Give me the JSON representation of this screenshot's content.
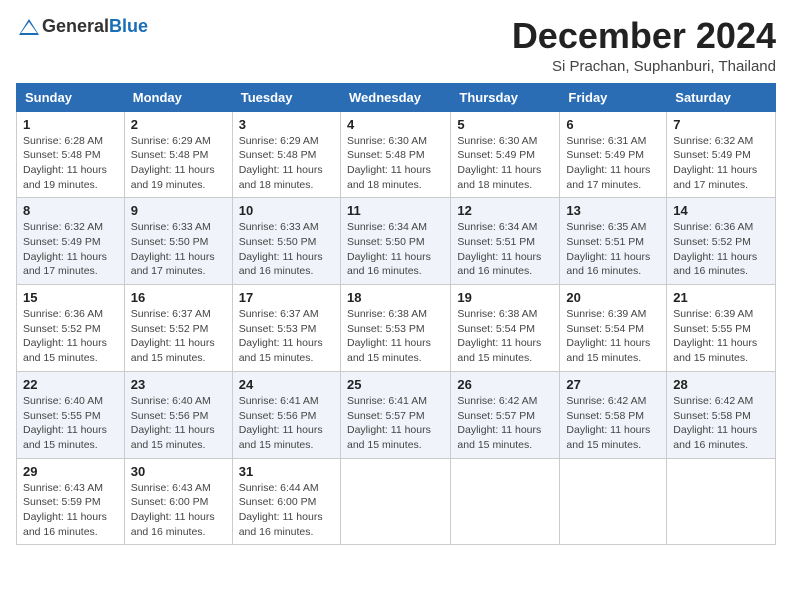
{
  "header": {
    "logo_general": "General",
    "logo_blue": "Blue",
    "title": "December 2024",
    "subtitle": "Si Prachan, Suphanburi, Thailand"
  },
  "weekdays": [
    "Sunday",
    "Monday",
    "Tuesday",
    "Wednesday",
    "Thursday",
    "Friday",
    "Saturday"
  ],
  "weeks": [
    [
      {
        "day": "1",
        "sunrise": "Sunrise: 6:28 AM",
        "sunset": "Sunset: 5:48 PM",
        "daylight": "Daylight: 11 hours and 19 minutes."
      },
      {
        "day": "2",
        "sunrise": "Sunrise: 6:29 AM",
        "sunset": "Sunset: 5:48 PM",
        "daylight": "Daylight: 11 hours and 19 minutes."
      },
      {
        "day": "3",
        "sunrise": "Sunrise: 6:29 AM",
        "sunset": "Sunset: 5:48 PM",
        "daylight": "Daylight: 11 hours and 18 minutes."
      },
      {
        "day": "4",
        "sunrise": "Sunrise: 6:30 AM",
        "sunset": "Sunset: 5:48 PM",
        "daylight": "Daylight: 11 hours and 18 minutes."
      },
      {
        "day": "5",
        "sunrise": "Sunrise: 6:30 AM",
        "sunset": "Sunset: 5:49 PM",
        "daylight": "Daylight: 11 hours and 18 minutes."
      },
      {
        "day": "6",
        "sunrise": "Sunrise: 6:31 AM",
        "sunset": "Sunset: 5:49 PM",
        "daylight": "Daylight: 11 hours and 17 minutes."
      },
      {
        "day": "7",
        "sunrise": "Sunrise: 6:32 AM",
        "sunset": "Sunset: 5:49 PM",
        "daylight": "Daylight: 11 hours and 17 minutes."
      }
    ],
    [
      {
        "day": "8",
        "sunrise": "Sunrise: 6:32 AM",
        "sunset": "Sunset: 5:49 PM",
        "daylight": "Daylight: 11 hours and 17 minutes."
      },
      {
        "day": "9",
        "sunrise": "Sunrise: 6:33 AM",
        "sunset": "Sunset: 5:50 PM",
        "daylight": "Daylight: 11 hours and 17 minutes."
      },
      {
        "day": "10",
        "sunrise": "Sunrise: 6:33 AM",
        "sunset": "Sunset: 5:50 PM",
        "daylight": "Daylight: 11 hours and 16 minutes."
      },
      {
        "day": "11",
        "sunrise": "Sunrise: 6:34 AM",
        "sunset": "Sunset: 5:50 PM",
        "daylight": "Daylight: 11 hours and 16 minutes."
      },
      {
        "day": "12",
        "sunrise": "Sunrise: 6:34 AM",
        "sunset": "Sunset: 5:51 PM",
        "daylight": "Daylight: 11 hours and 16 minutes."
      },
      {
        "day": "13",
        "sunrise": "Sunrise: 6:35 AM",
        "sunset": "Sunset: 5:51 PM",
        "daylight": "Daylight: 11 hours and 16 minutes."
      },
      {
        "day": "14",
        "sunrise": "Sunrise: 6:36 AM",
        "sunset": "Sunset: 5:52 PM",
        "daylight": "Daylight: 11 hours and 16 minutes."
      }
    ],
    [
      {
        "day": "15",
        "sunrise": "Sunrise: 6:36 AM",
        "sunset": "Sunset: 5:52 PM",
        "daylight": "Daylight: 11 hours and 15 minutes."
      },
      {
        "day": "16",
        "sunrise": "Sunrise: 6:37 AM",
        "sunset": "Sunset: 5:52 PM",
        "daylight": "Daylight: 11 hours and 15 minutes."
      },
      {
        "day": "17",
        "sunrise": "Sunrise: 6:37 AM",
        "sunset": "Sunset: 5:53 PM",
        "daylight": "Daylight: 11 hours and 15 minutes."
      },
      {
        "day": "18",
        "sunrise": "Sunrise: 6:38 AM",
        "sunset": "Sunset: 5:53 PM",
        "daylight": "Daylight: 11 hours and 15 minutes."
      },
      {
        "day": "19",
        "sunrise": "Sunrise: 6:38 AM",
        "sunset": "Sunset: 5:54 PM",
        "daylight": "Daylight: 11 hours and 15 minutes."
      },
      {
        "day": "20",
        "sunrise": "Sunrise: 6:39 AM",
        "sunset": "Sunset: 5:54 PM",
        "daylight": "Daylight: 11 hours and 15 minutes."
      },
      {
        "day": "21",
        "sunrise": "Sunrise: 6:39 AM",
        "sunset": "Sunset: 5:55 PM",
        "daylight": "Daylight: 11 hours and 15 minutes."
      }
    ],
    [
      {
        "day": "22",
        "sunrise": "Sunrise: 6:40 AM",
        "sunset": "Sunset: 5:55 PM",
        "daylight": "Daylight: 11 hours and 15 minutes."
      },
      {
        "day": "23",
        "sunrise": "Sunrise: 6:40 AM",
        "sunset": "Sunset: 5:56 PM",
        "daylight": "Daylight: 11 hours and 15 minutes."
      },
      {
        "day": "24",
        "sunrise": "Sunrise: 6:41 AM",
        "sunset": "Sunset: 5:56 PM",
        "daylight": "Daylight: 11 hours and 15 minutes."
      },
      {
        "day": "25",
        "sunrise": "Sunrise: 6:41 AM",
        "sunset": "Sunset: 5:57 PM",
        "daylight": "Daylight: 11 hours and 15 minutes."
      },
      {
        "day": "26",
        "sunrise": "Sunrise: 6:42 AM",
        "sunset": "Sunset: 5:57 PM",
        "daylight": "Daylight: 11 hours and 15 minutes."
      },
      {
        "day": "27",
        "sunrise": "Sunrise: 6:42 AM",
        "sunset": "Sunset: 5:58 PM",
        "daylight": "Daylight: 11 hours and 15 minutes."
      },
      {
        "day": "28",
        "sunrise": "Sunrise: 6:42 AM",
        "sunset": "Sunset: 5:58 PM",
        "daylight": "Daylight: 11 hours and 16 minutes."
      }
    ],
    [
      {
        "day": "29",
        "sunrise": "Sunrise: 6:43 AM",
        "sunset": "Sunset: 5:59 PM",
        "daylight": "Daylight: 11 hours and 16 minutes."
      },
      {
        "day": "30",
        "sunrise": "Sunrise: 6:43 AM",
        "sunset": "Sunset: 6:00 PM",
        "daylight": "Daylight: 11 hours and 16 minutes."
      },
      {
        "day": "31",
        "sunrise": "Sunrise: 6:44 AM",
        "sunset": "Sunset: 6:00 PM",
        "daylight": "Daylight: 11 hours and 16 minutes."
      },
      null,
      null,
      null,
      null
    ]
  ]
}
